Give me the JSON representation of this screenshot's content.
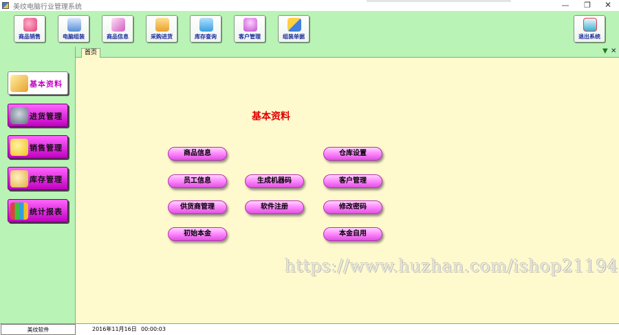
{
  "window": {
    "title": "美纹电脑行业管理系统",
    "min_glyph": "—",
    "max_glyph": "❐",
    "close_glyph": "✕"
  },
  "toolbar": {
    "buttons": [
      {
        "label": "商品销售",
        "icon": "sales-icon",
        "color": "#e0407a"
      },
      {
        "label": "电脑组装",
        "icon": "computer-icon",
        "color": "#5a8fd6"
      },
      {
        "label": "商品信息",
        "icon": "product-info-icon",
        "color": "#d060c0"
      },
      {
        "label": "采购进货",
        "icon": "purchase-icon",
        "color": "#e8a030"
      },
      {
        "label": "库存查询",
        "icon": "inventory-icon",
        "color": "#3aa0e0"
      },
      {
        "label": "客户管理",
        "icon": "customer-icon",
        "color": "#c050d0"
      },
      {
        "label": "组装单据",
        "icon": "assembly-doc-icon",
        "color": "#4080e0"
      },
      {
        "label": "退出系统",
        "icon": "exit-icon",
        "color": "#40b0d0"
      }
    ]
  },
  "sidebar": {
    "items": [
      {
        "label": "基本资料",
        "icon": "basic-data-icon",
        "color": "#e8a030",
        "active": true
      },
      {
        "label": "进货管理",
        "icon": "purchase-manage-icon",
        "color": "#607080",
        "active": false
      },
      {
        "label": "销售管理",
        "icon": "sales-manage-icon",
        "color": "#f0c020",
        "active": false
      },
      {
        "label": "库存管理",
        "icon": "stock-manage-icon",
        "color": "#e0b040",
        "active": false
      },
      {
        "label": "统计报表",
        "icon": "report-icon",
        "color": "#30a0e0",
        "active": false
      }
    ]
  },
  "tabs": {
    "active_label": "首页",
    "dropdown_glyph": "▼",
    "close_glyph": "✕"
  },
  "main": {
    "heading": "基本资料",
    "buttons": {
      "product_info": "商品信息",
      "warehouse_settings": "仓库设置",
      "employee_info": "员工信息",
      "generate_machine_code": "生成机器码",
      "customer_manage": "客户管理",
      "supplier_manage": "供货商管理",
      "software_register": "软件注册",
      "change_password": "修改密码",
      "initial_capital": "初始本金",
      "capital_self_use": "本金自用"
    },
    "watermark": "https://www.huzhan.com/ishop21194"
  },
  "status": {
    "company": "美纹软件",
    "date": "2016年11月16日",
    "time": "00:00:03"
  },
  "colors": {
    "green_panel": "#b9f3b5",
    "content_bg": "#fffacd",
    "heading": "#e00000",
    "pill": "#ff8cff",
    "side_button": "#e020e0"
  }
}
